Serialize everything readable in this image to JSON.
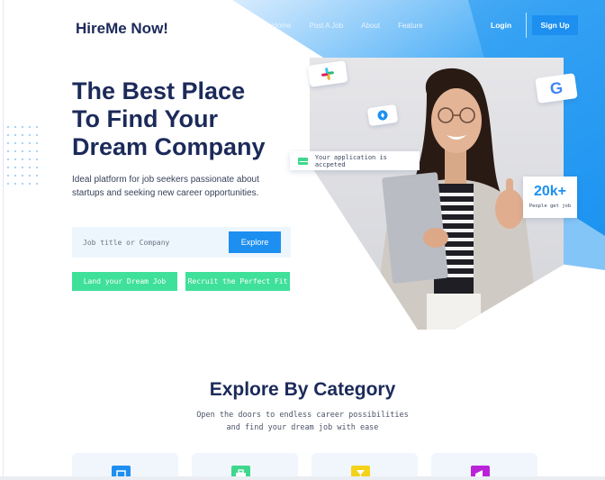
{
  "brand": "HireMe Now!",
  "nav": {
    "items": [
      "Home",
      "Post A Job",
      "About",
      "Feature"
    ]
  },
  "auth": {
    "login": "Login",
    "signup": "Sign Up"
  },
  "hero": {
    "title_lines": [
      "The Best Place",
      "To Find Your",
      "Dream Company"
    ],
    "subtitle": "Ideal platform for job seekers passionate about startups and seeking new career opportunities.",
    "search_placeholder": "Job title or Company",
    "explore_label": "Explore",
    "cta_primary": "Land your Dream Job",
    "cta_secondary": "Recruit the Perfect Fit"
  },
  "notifications": {
    "application": "Your application is accpeted",
    "stat_value": "20k+",
    "stat_label": "People get job"
  },
  "badges": [
    "slack-icon",
    "google-icon",
    "blue-app-icon"
  ],
  "category": {
    "title": "Explore By Category",
    "subtitle_lines": [
      "Open the doors to endless career possibilities",
      "and find your dream job with ease"
    ],
    "icons": [
      "monitor-icon",
      "briefcase-icon",
      "hourglass-icon",
      "megaphone-icon"
    ]
  },
  "colors": {
    "accent_blue": "#1d8ff0",
    "accent_green": "#3fe09a",
    "title_navy": "#1c2a5a",
    "category_icons": [
      "#1d8ff0",
      "#3fd78e",
      "#f4d21c",
      "#b924d8"
    ]
  }
}
